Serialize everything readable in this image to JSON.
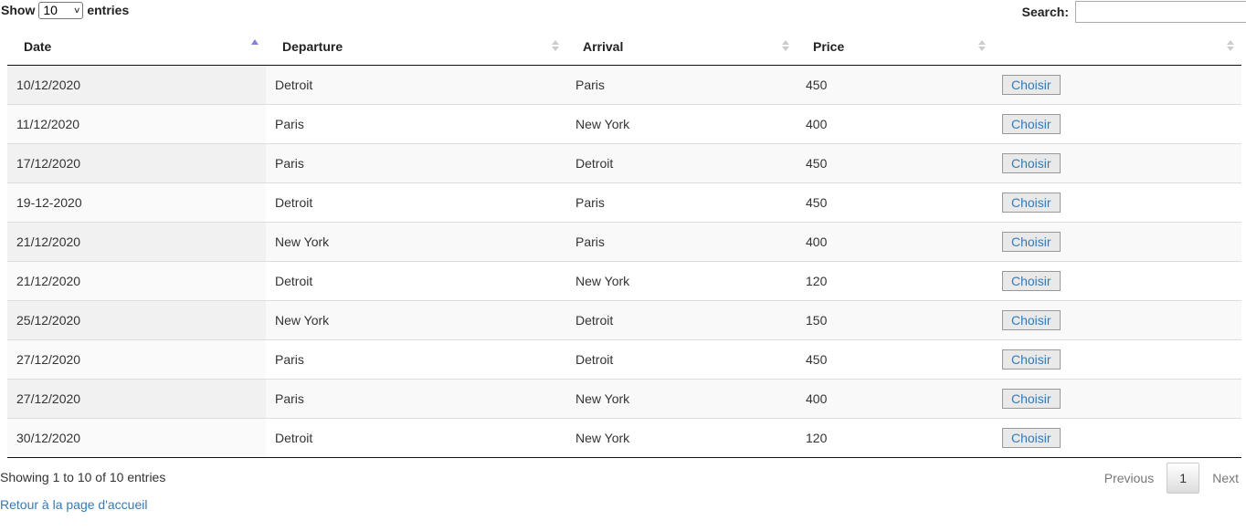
{
  "controls": {
    "show_label": "Show",
    "page_length": "10",
    "entries_label": "entries",
    "search_label": "Search:",
    "search_value": ""
  },
  "table": {
    "columns": [
      {
        "label": "Date",
        "sort": "ascending"
      },
      {
        "label": "Departure",
        "sort": "none"
      },
      {
        "label": "Arrival",
        "sort": "none"
      },
      {
        "label": "Price",
        "sort": "none"
      },
      {
        "label": "",
        "sort": "none"
      }
    ],
    "rows": [
      {
        "date": "10/12/2020",
        "departure": "Detroit",
        "arrival": "Paris",
        "price": "450",
        "action": "Choisir"
      },
      {
        "date": "11/12/2020",
        "departure": "Paris",
        "arrival": "New York",
        "price": "400",
        "action": "Choisir"
      },
      {
        "date": "17/12/2020",
        "departure": "Paris",
        "arrival": "Detroit",
        "price": "450",
        "action": "Choisir"
      },
      {
        "date": "19-12-2020",
        "departure": "Detroit",
        "arrival": "Paris",
        "price": "450",
        "action": "Choisir"
      },
      {
        "date": "21/12/2020",
        "departure": "New York",
        "arrival": "Paris",
        "price": "400",
        "action": "Choisir"
      },
      {
        "date": "21/12/2020",
        "departure": "Detroit",
        "arrival": "New York",
        "price": "120",
        "action": "Choisir"
      },
      {
        "date": "25/12/2020",
        "departure": "New York",
        "arrival": "Detroit",
        "price": "150",
        "action": "Choisir"
      },
      {
        "date": "27/12/2020",
        "departure": "Paris",
        "arrival": "Detroit",
        "price": "450",
        "action": "Choisir"
      },
      {
        "date": "27/12/2020",
        "departure": "Paris",
        "arrival": "New York",
        "price": "400",
        "action": "Choisir"
      },
      {
        "date": "30/12/2020",
        "departure": "Detroit",
        "arrival": "New York",
        "price": "120",
        "action": "Choisir"
      }
    ]
  },
  "footer": {
    "info": "Showing 1 to 10 of 10 entries",
    "previous": "Previous",
    "current_page": "1",
    "next": "Next",
    "home_link": "Retour à la page d'accueil"
  },
  "icons": {
    "sort_active": "sort-asc-icon",
    "sort_inactive": "sort-both-icon",
    "select_arrow": "chevron-down-icon"
  },
  "colors": {
    "link": "#337ab7",
    "sort_active": "#8183d7",
    "sort_inactive": "#cccccc"
  }
}
